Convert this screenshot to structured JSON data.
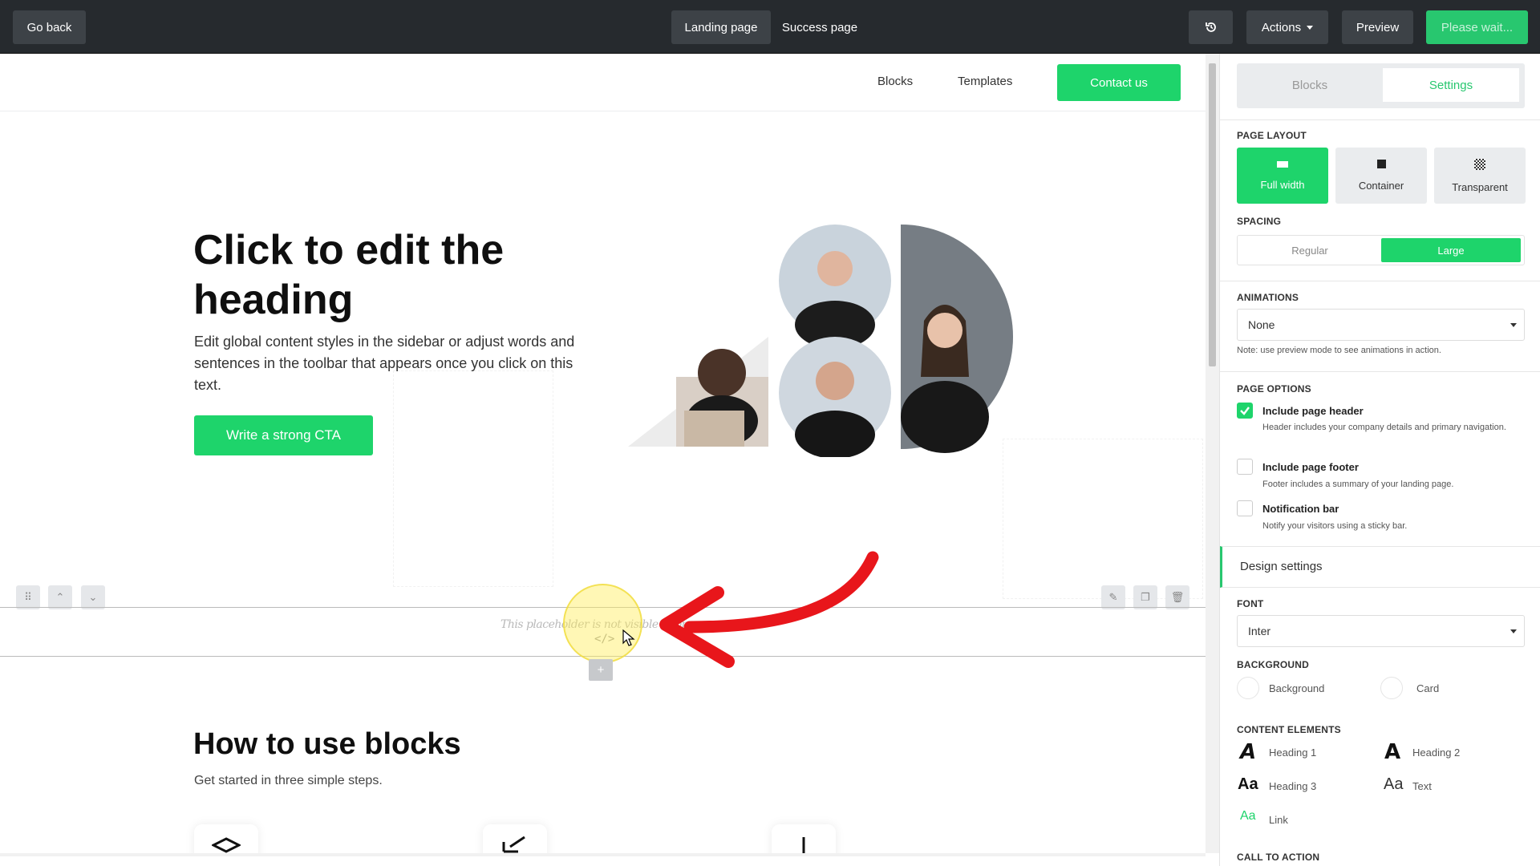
{
  "topbar": {
    "go_back": "Go back",
    "tabs": [
      "Landing page",
      "Success page"
    ],
    "actions": "Actions",
    "preview": "Preview",
    "please_wait": "Please wait..."
  },
  "site_nav": {
    "links": [
      "Blocks",
      "Templates"
    ],
    "contact": "Contact us"
  },
  "hero": {
    "heading": "Click to edit the heading",
    "text": "Edit global content styles in the sidebar or adjust words and sentences in the toolbar that appears once you click on this text.",
    "cta": "Write a strong CTA"
  },
  "placeholder": {
    "text": "This placeholder is not visible in pre",
    "code_icon": "</>"
  },
  "blocks_section": {
    "heading": "How to use blocks",
    "subtitle": "Get started in three simple steps."
  },
  "sidebar": {
    "tabs": [
      "Blocks",
      "Settings"
    ],
    "page_layout": {
      "label": "PAGE LAYOUT",
      "options": [
        "Full width",
        "Container",
        "Transparent"
      ],
      "selected": "Full width"
    },
    "spacing": {
      "label": "SPACING",
      "options": [
        "Regular",
        "Large"
      ],
      "selected": "Large"
    },
    "animations": {
      "label": "ANIMATIONS",
      "value": "None",
      "note": "Note: use preview mode to see animations in action."
    },
    "page_options": {
      "label": "PAGE OPTIONS",
      "items": [
        {
          "title": "Include page header",
          "desc": "Header includes your company details and primary navigation.",
          "checked": true
        },
        {
          "title": "Include page footer",
          "desc": "Footer includes a summary of your landing page.",
          "checked": false
        },
        {
          "title": "Notification bar",
          "desc": "Notify your visitors using a sticky bar.",
          "checked": false
        }
      ]
    },
    "design_settings": "Design settings",
    "font": {
      "label": "FONT",
      "value": "Inter"
    },
    "background": {
      "label": "BACKGROUND",
      "items": [
        "Background",
        "Card"
      ]
    },
    "content_elements": {
      "label": "CONTENT ELEMENTS",
      "items": [
        "Heading 1",
        "Heading 2",
        "Heading 3",
        "Text",
        "Link"
      ]
    },
    "call_to_action": "CALL TO ACTION"
  },
  "colors": {
    "accent": "#1ed46b",
    "topbar": "#262a2e",
    "annotation_arrow": "#e8161b"
  }
}
